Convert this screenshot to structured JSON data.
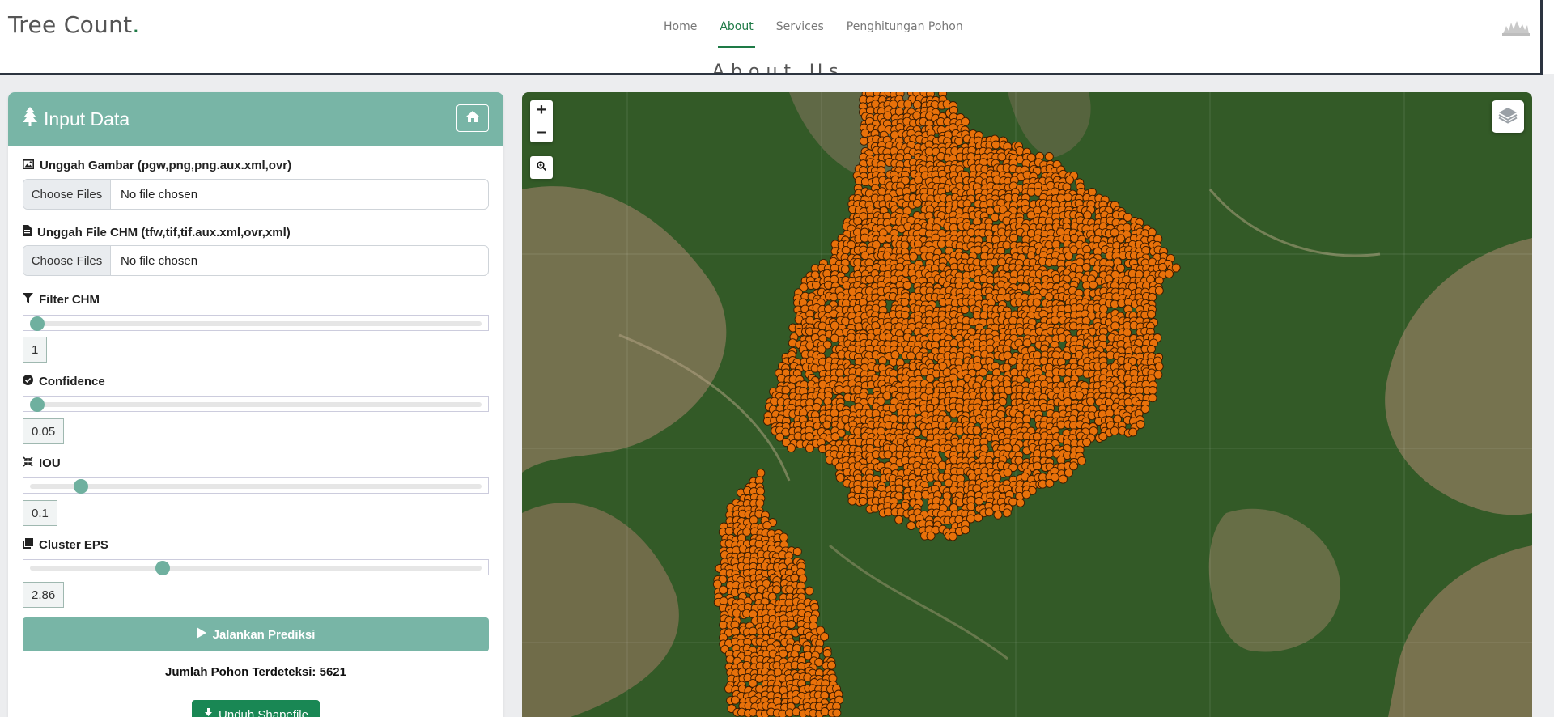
{
  "header": {
    "brand": "Tree Count",
    "brand_dot": ".",
    "nav": [
      {
        "label": "Home",
        "active": false
      },
      {
        "label": "About",
        "active": true
      },
      {
        "label": "Services",
        "active": false
      },
      {
        "label": "Penghitungan Pohon",
        "active": false
      }
    ],
    "peek_text": "About Us"
  },
  "panel": {
    "title": "Input Data",
    "title_icon": "tree-icon",
    "home_icon": "home-icon",
    "upload_image": {
      "label": "Unggah Gambar (pgw,png,png.aux.xml,ovr)",
      "button": "Choose Files",
      "status": "No file chosen"
    },
    "upload_chm": {
      "label": "Unggah File CHM (tfw,tif,tif.aux.xml,ovr,xml)",
      "button": "Choose Files",
      "status": "No file chosen"
    },
    "filter_chm": {
      "label": "Filter CHM",
      "value": "1",
      "fraction": 0.0
    },
    "confidence": {
      "label": "Confidence",
      "value": "0.05",
      "fraction": 0.0
    },
    "iou": {
      "label": "IOU",
      "value": "0.1",
      "fraction": 0.1
    },
    "cluster_eps": {
      "label": "Cluster EPS",
      "value": "2.86",
      "fraction": 0.286
    },
    "run_button": "Jalankan Prediksi",
    "count_label": "Jumlah Pohon Terdeteksi:",
    "count_value": "5621",
    "download_button": "Unduh Shapefile"
  },
  "map": {
    "zoom_in": "+",
    "zoom_out": "–",
    "marker_color": "#e8710a",
    "marker_stroke": "#3a1a00"
  }
}
